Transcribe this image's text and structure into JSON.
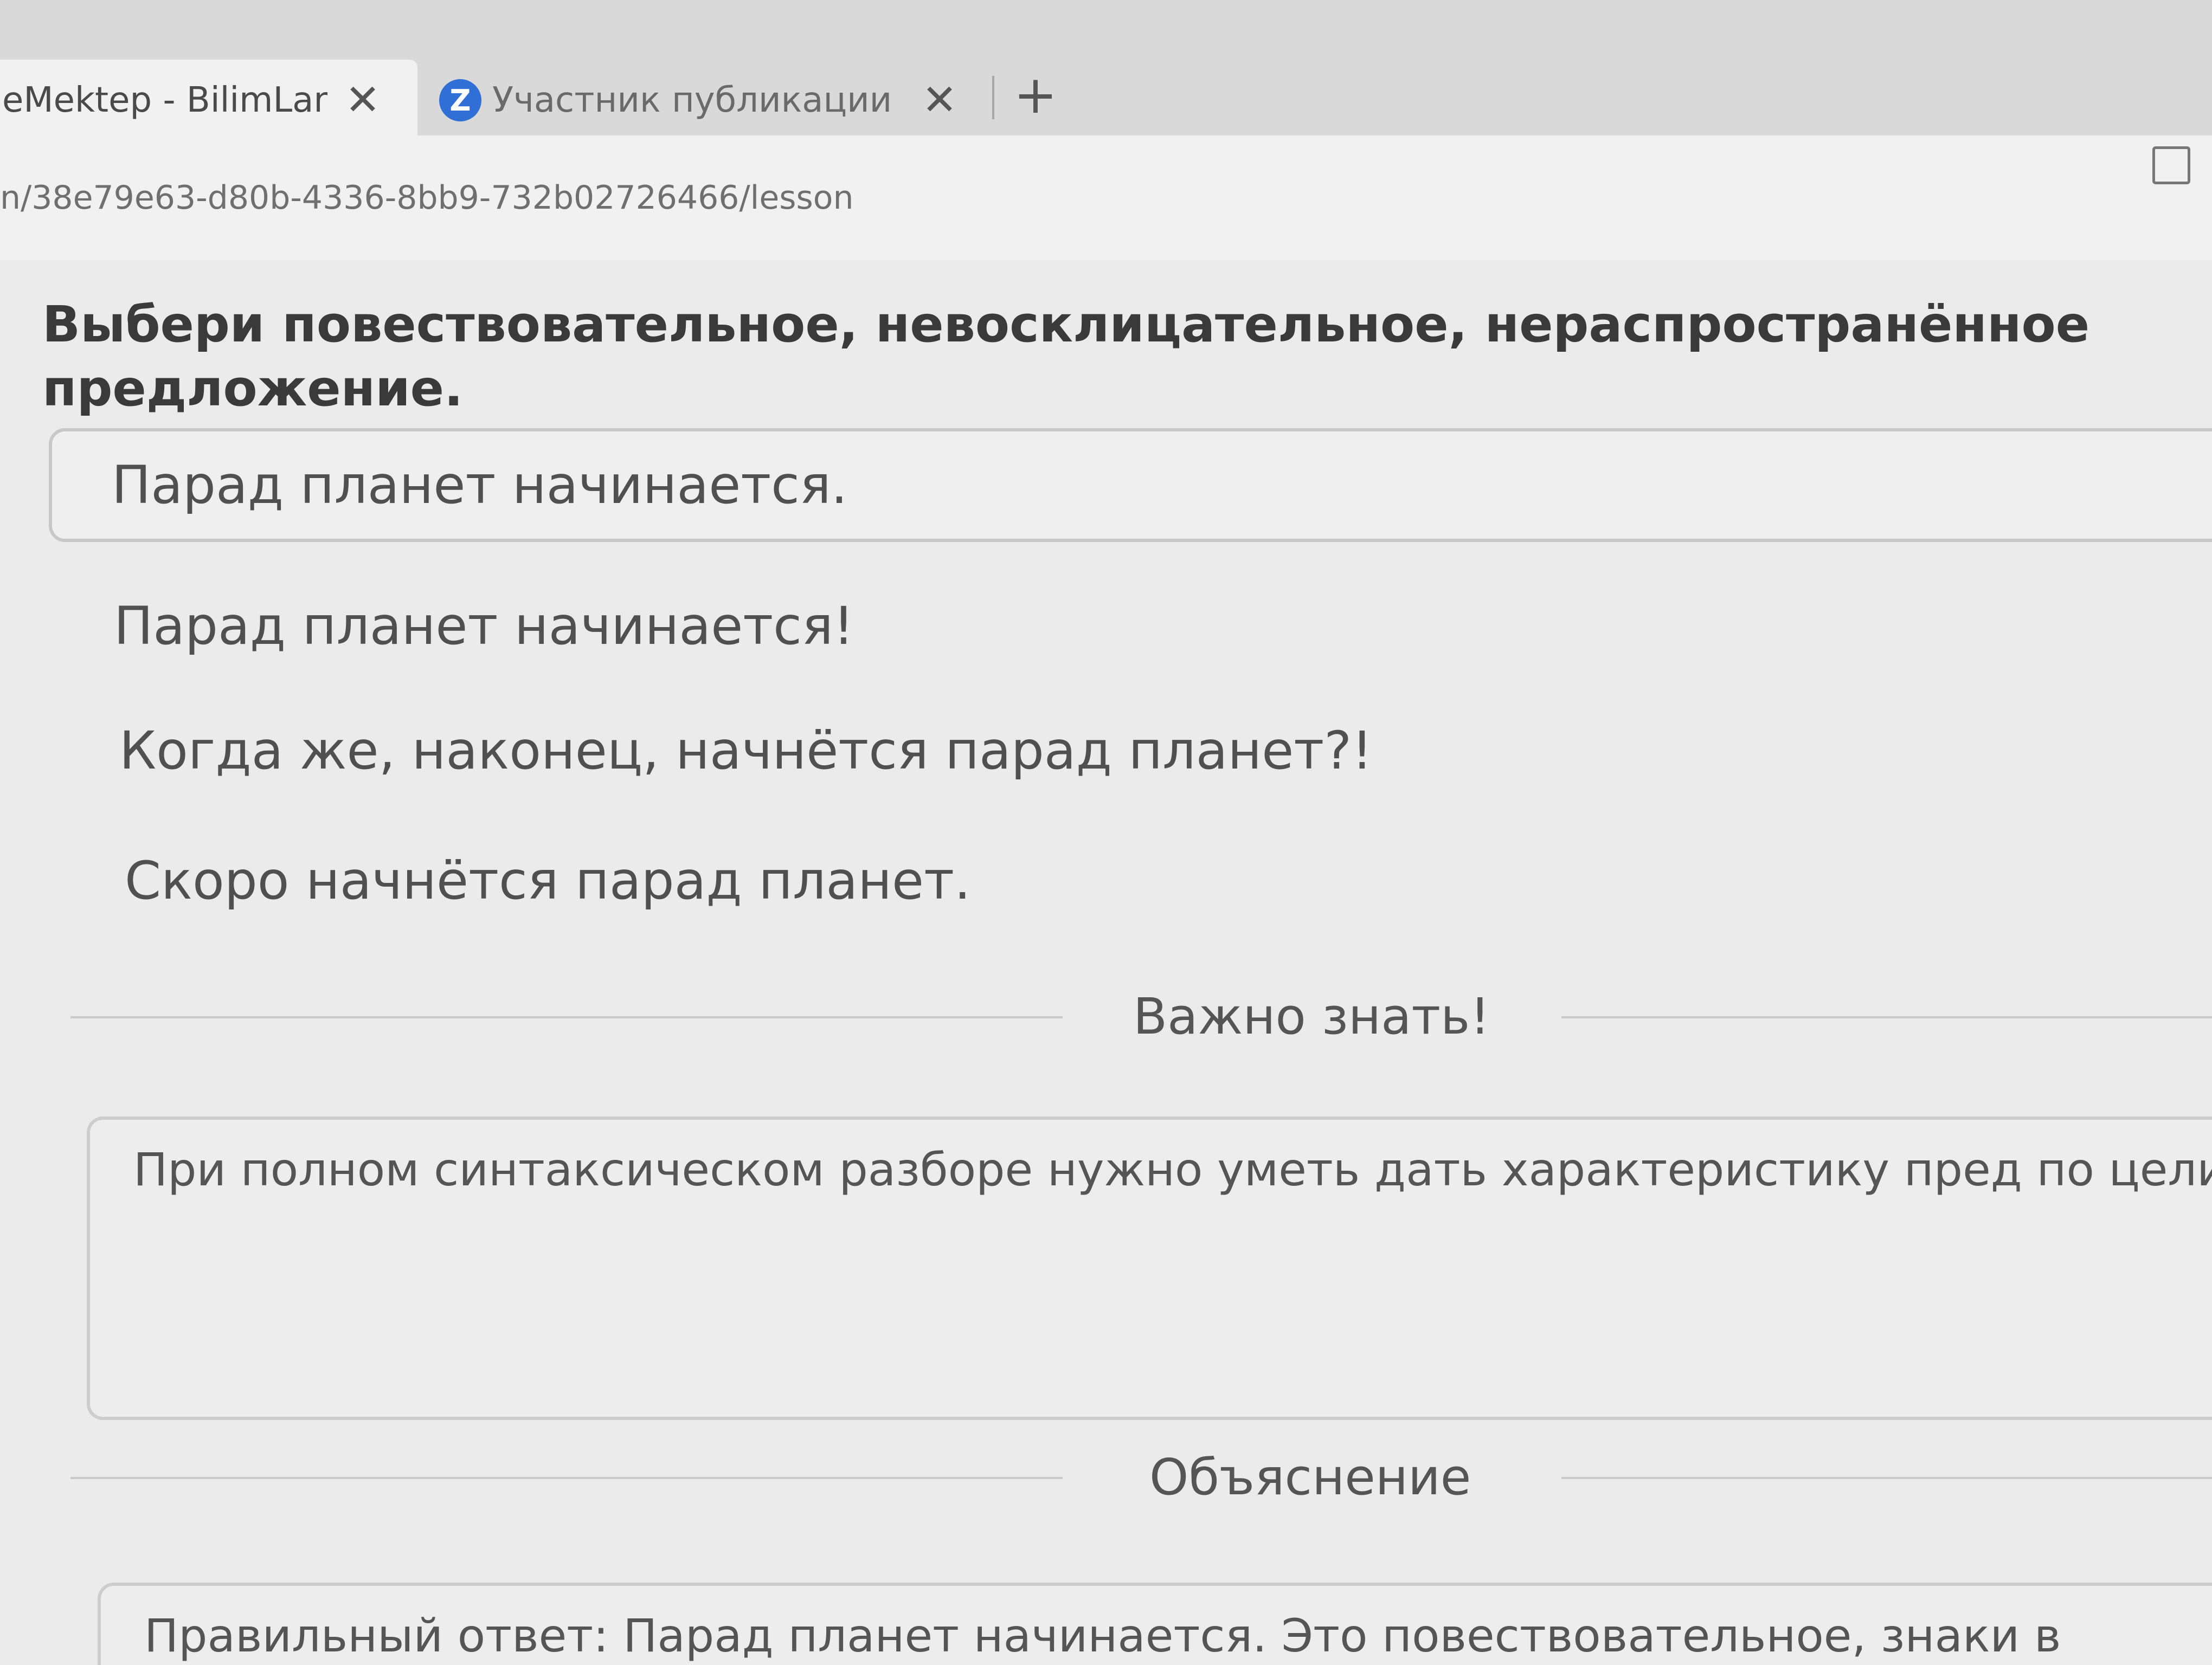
{
  "browser": {
    "tabs": [
      {
        "title": "eMektep - BilimLand",
        "active": true
      },
      {
        "title": "Участник публикации - Z",
        "favicon_letter": "Z",
        "active": false
      }
    ],
    "close_glyph": "✕",
    "new_tab_glyph": "+",
    "url": "n/38e79e63-d80b-4336-8bb9-732b02726466/lesson",
    "accent_color": "#2f6fd6"
  },
  "lesson": {
    "question": "Выбери повествовательное, невосклицательное, нераспространённое предложение.",
    "options": [
      {
        "text": "Парад планет начинается.",
        "selected": true
      },
      {
        "text": "Парад планет начинается!",
        "selected": false
      },
      {
        "text": "Когда же, наконец, начнётся парад планет?!",
        "selected": false
      },
      {
        "text": "Скоро начнётся парад планет.",
        "selected": false
      }
    ],
    "important": {
      "heading": "Важно знать!",
      "text": "При полном синтаксическом разборе нужно уметь дать характеристику пред по цели высказывания (повествовательное, вопросительное, побудительное интонации (восклицательное/невосклицательное,), отметить какое это пред по наличию второстепенных членов (распространённое/нераспространённ"
    },
    "explanation": {
      "heading": "Объяснение",
      "text": "Правильный ответ: Парад планет начинается. Это повествовательное, знаки в конце предложения это подтверж"
    }
  }
}
